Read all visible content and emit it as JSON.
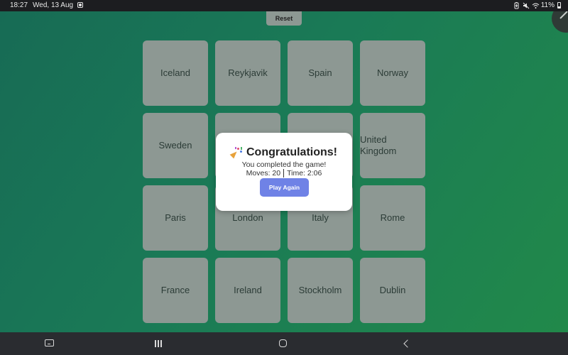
{
  "status_bar": {
    "time": "18:27",
    "date": "Wed, 13 Aug",
    "battery": "11%"
  },
  "game": {
    "reset_label": "Reset",
    "cards": [
      "Iceland",
      "Reykjavik",
      "Spain",
      "Norway",
      "Sweden",
      "",
      "",
      "United Kingdom",
      "Paris",
      "London",
      "Italy",
      "Rome",
      "France",
      "Ireland",
      "Stockholm",
      "Dublin"
    ]
  },
  "modal": {
    "title": "Congratulations!",
    "message": "You completed the game!",
    "moves": "Moves: 20",
    "time": "Time: 2:06",
    "play_again_label": "Play Again"
  },
  "colors": {
    "background_start": "#176b55",
    "background_end": "#21894a",
    "card": "#8d9893",
    "card_text": "#2c3c37",
    "button_accent": "#6f82e6"
  },
  "icons": {
    "status_left": "notification-icon",
    "status_right": [
      "battery-saver-icon",
      "mute-icon",
      "wifi-icon",
      "battery-icon"
    ],
    "corner": "pen-icon",
    "nav": [
      "keyboard-icon",
      "recent-apps-icon",
      "home-icon",
      "back-icon"
    ]
  }
}
